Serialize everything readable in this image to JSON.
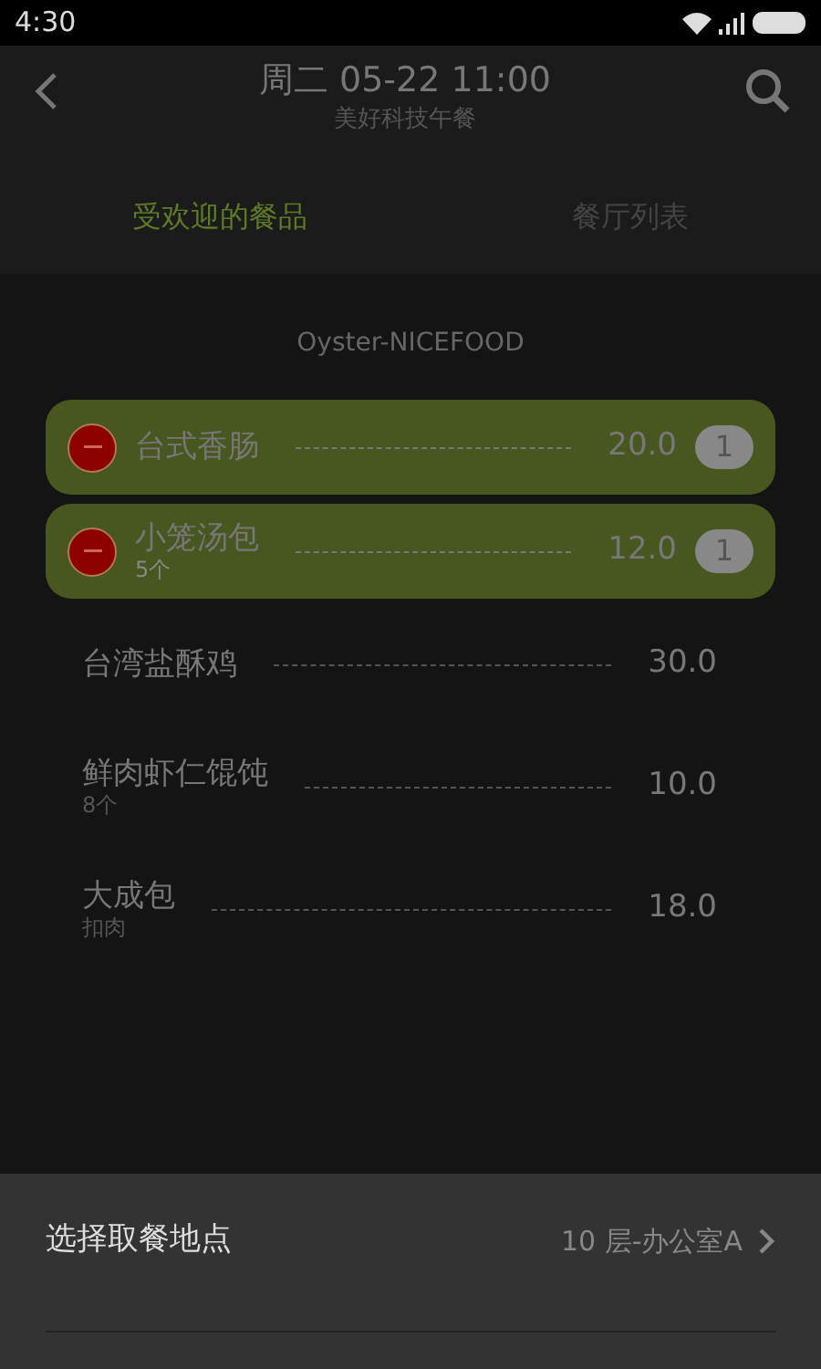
{
  "status_bar": {
    "time": "4:30"
  },
  "header": {
    "title": "周二 05-22 11:00",
    "subtitle": "美好科技午餐"
  },
  "tabs": [
    {
      "label": "受欢迎的餐品",
      "selected": true
    },
    {
      "label": "餐厅列表",
      "selected": false
    }
  ],
  "restaurant": "Oyster-NICEFOOD",
  "dishes": [
    {
      "name": "台式香肠",
      "price": "20.0",
      "selected": true,
      "count": "1"
    },
    {
      "name": "小笼汤包",
      "note": "5个",
      "price": "12.0",
      "selected": true,
      "count": "1"
    },
    {
      "name": "台湾盐酥鸡",
      "price": "30.0",
      "selected": false
    },
    {
      "name": "鲜肉虾仁馄饨",
      "note": "8个",
      "price": "10.0",
      "selected": false
    },
    {
      "name": "大成包",
      "note": "扣肉",
      "price": "18.0",
      "selected": false
    }
  ],
  "pickup": {
    "label": "选择取餐地点",
    "value": "10 层-办公室A"
  }
}
